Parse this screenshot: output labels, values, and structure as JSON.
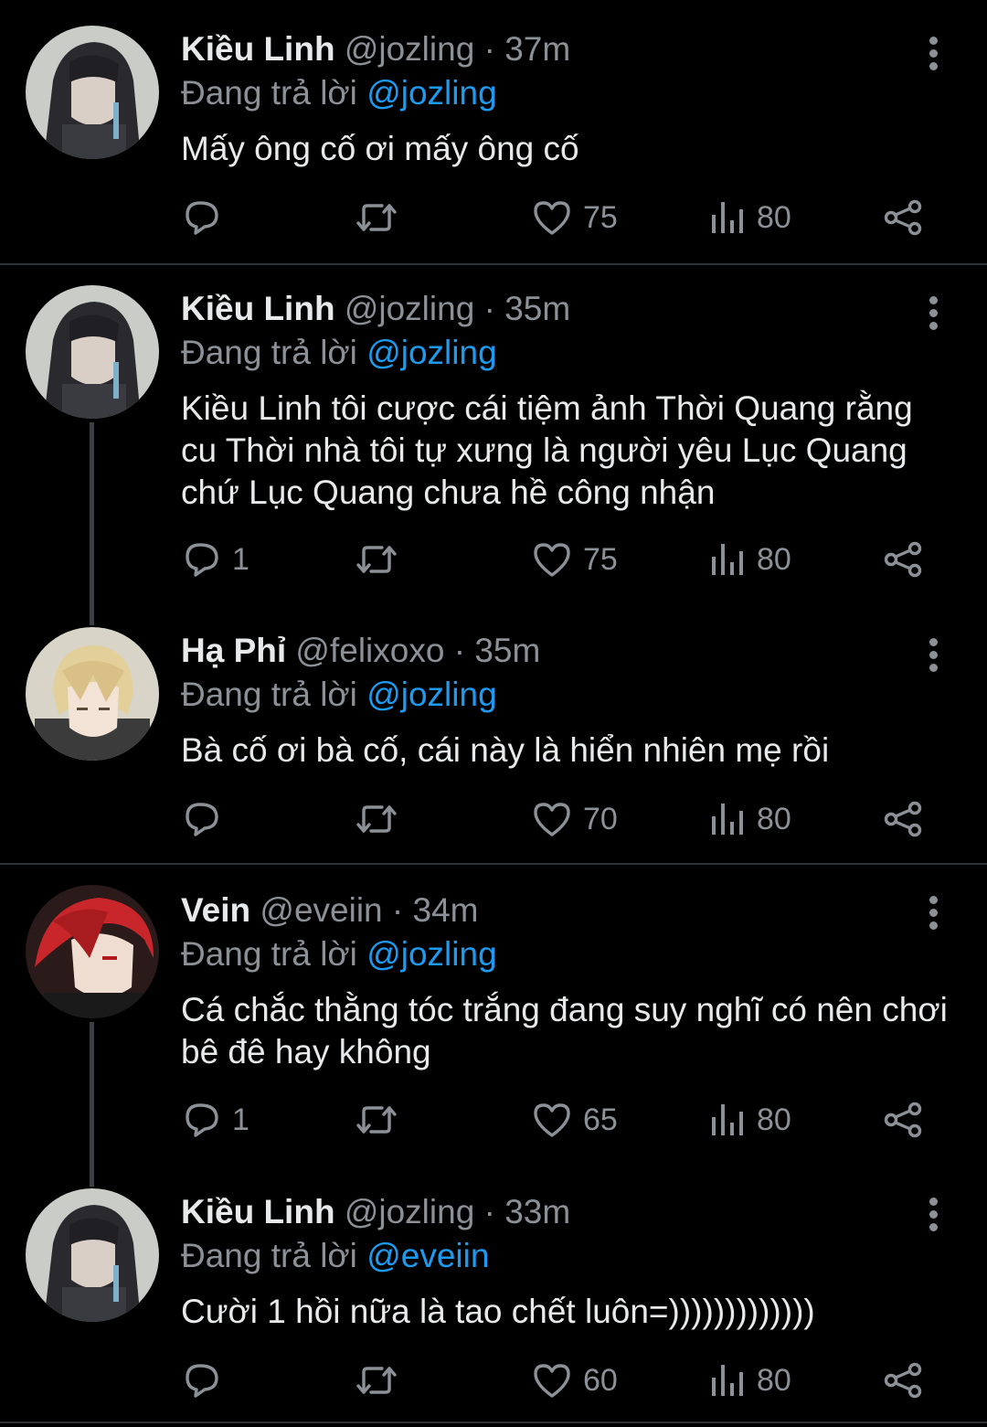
{
  "ui": {
    "reply_prefix": "Đang trả lời",
    "separator": "·"
  },
  "colors": {
    "background": "#000000",
    "mention": "#1d9bf0",
    "muted": "#8b9197",
    "divider": "#2f3336"
  },
  "tweets": [
    {
      "name": "Kiều Linh",
      "handle": "@jozling",
      "time": "37m",
      "reply_to": "@jozling",
      "text": "Mấy ông cố ơi mấy ông cố",
      "replies": "",
      "likes": "75",
      "views": "80",
      "avatar": "dark-hair-avatar"
    },
    {
      "name": "Kiều Linh",
      "handle": "@jozling",
      "time": "35m",
      "reply_to": "@jozling",
      "text": "Kiều Linh tôi cược cái tiệm ảnh Thời Quang rằng cu Thời nhà tôi tự xưng là người yêu Lục Quang chứ Lục Quang chưa hề công nhận",
      "replies": "1",
      "likes": "75",
      "views": "80",
      "avatar": "dark-hair-avatar"
    },
    {
      "name": "Hạ Phỉ",
      "handle": "@felixoxo",
      "time": "35m",
      "reply_to": "@jozling",
      "text": "Bà cố ơi bà cố, cái này là hiển nhiên mẹ rồi",
      "replies": "",
      "likes": "70",
      "views": "80",
      "avatar": "blonde-hair-avatar"
    },
    {
      "name": "Vein",
      "handle": "@eveiin",
      "time": "34m",
      "reply_to": "@jozling",
      "text": "Cá chắc thằng tóc trắng đang suy nghĩ có nên chơi bê đê hay không",
      "replies": "1",
      "likes": "65",
      "views": "80",
      "avatar": "red-hair-avatar"
    },
    {
      "name": "Kiều Linh",
      "handle": "@jozling",
      "time": "33m",
      "reply_to": "@eveiin",
      "text": "Cười 1 hồi nữa là tao chết luôn=)))))))))))))",
      "replies": "",
      "likes": "60",
      "views": "80",
      "avatar": "dark-hair-avatar"
    }
  ]
}
